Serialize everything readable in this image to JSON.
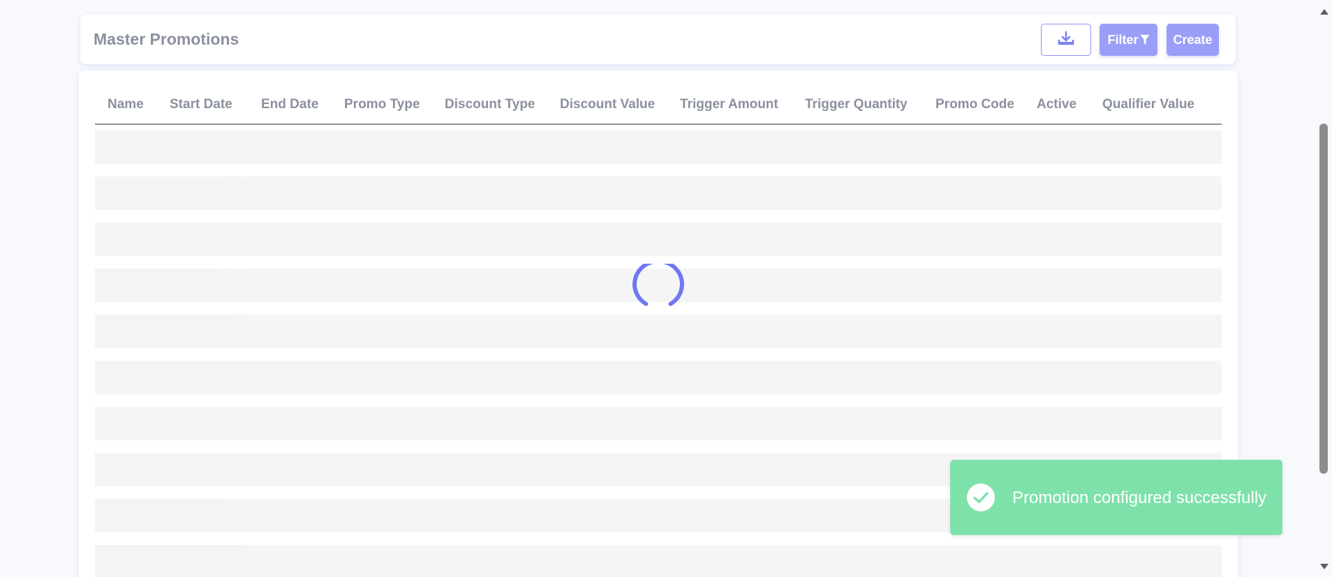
{
  "header": {
    "title": "Master Promotions",
    "download_icon": "download-icon",
    "filter_label": "Filter",
    "filter_icon": "funnel-icon",
    "create_label": "Create"
  },
  "table": {
    "columns": [
      "Name",
      "Start Date",
      "End Date",
      "Promo Type",
      "Discount Type",
      "Discount Value",
      "Trigger Amount",
      "Trigger Quantity",
      "Promo Code",
      "Active",
      "Qualifier Value"
    ],
    "loading": true,
    "placeholder_rows": 10
  },
  "toast": {
    "message": "Promotion configured successfully",
    "icon": "check-circle-icon",
    "color": "#7fe1aa"
  },
  "colors": {
    "accent": "#9b9ef6",
    "accent_border": "#8b90f2",
    "spinner": "#7077f0",
    "text_muted": "#8a919d",
    "background": "#f8f9fd"
  }
}
